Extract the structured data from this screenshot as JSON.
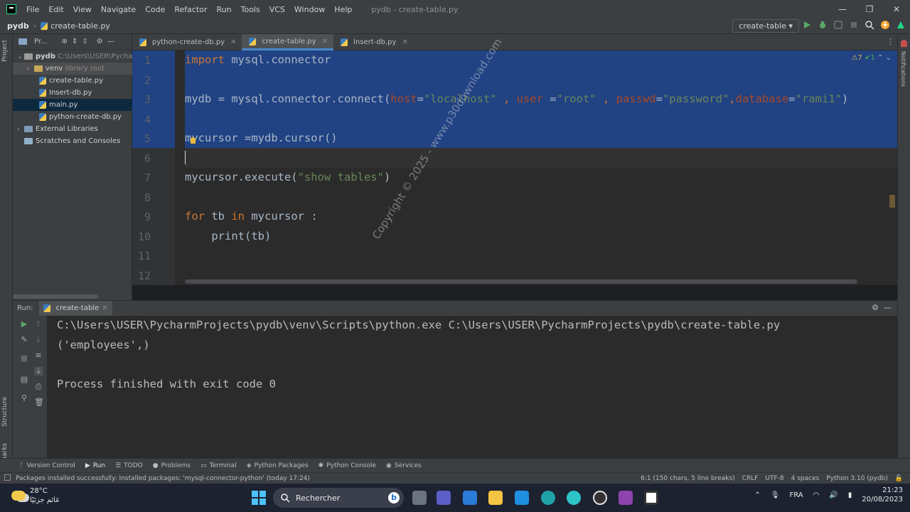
{
  "titlebar": {
    "menu": [
      "File",
      "Edit",
      "View",
      "Navigate",
      "Code",
      "Refactor",
      "Run",
      "Tools",
      "VCS",
      "Window",
      "Help"
    ],
    "title": "pydb - create-table.py",
    "controls": [
      "—",
      "❐",
      "✕"
    ]
  },
  "navbar": {
    "project": "pydb",
    "file": "create-table.py",
    "run_config": "create-table ▾"
  },
  "left_strip": {
    "project": "Project",
    "structure": "Structure",
    "bookmarks": "Bookmarks"
  },
  "right_strip": {
    "notifications": "Notifications"
  },
  "project_panel": {
    "header": "Pr...",
    "tree": [
      {
        "label": "pydb",
        "extra": "C:\\Users\\USER\\Pycharm"
      },
      {
        "label": "venv",
        "extra": "library root"
      },
      {
        "label": "create-table.py"
      },
      {
        "label": "Insert-db.py"
      },
      {
        "label": "main.py"
      },
      {
        "label": "python-create-db.py"
      },
      {
        "label": "External Libraries"
      },
      {
        "label": "Scratches and Consoles"
      }
    ]
  },
  "tabs": [
    {
      "label": "python-create-db.py"
    },
    {
      "label": "create-table.py"
    },
    {
      "label": "Insert-db.py"
    }
  ],
  "editor": {
    "inspections": {
      "warnings": "⚠7",
      "ok": "✔1"
    },
    "line_numbers": [
      "1",
      "2",
      "3",
      "4",
      "5",
      "6",
      "7",
      "8",
      "9",
      "10",
      "11",
      "12"
    ],
    "lines": {
      "l1_kw": "import",
      "l1_rest": " mysql.connector",
      "l3_a": "mydb = mysql.connector.connect(",
      "l3_host": "host",
      "l3_eq1": "=",
      "l3_hostval": "\"localhost\"",
      "l3_sep1": " , ",
      "l3_user": "user",
      "l3_eq2": " =",
      "l3_userval": "\"root\"",
      "l3_sep2": " , ",
      "l3_passwd": "passwd",
      "l3_eq3": "=",
      "l3_passval": "\"password\"",
      "l3_sep3": ",",
      "l3_db": "database",
      "l3_eq4": "=",
      "l3_dbval": "\"rami1\"",
      "l3_close": ")",
      "l5": "mycursor =mydb.cursor()",
      "l7_a": "mycursor.execute(",
      "l7_str": "\"show tables\"",
      "l7_b": ")",
      "l9_for": "for",
      "l9_mid": " tb ",
      "l9_in": "in",
      "l9_rest": " mycursor :",
      "l10": "    print(tb)"
    }
  },
  "watermark": "Copyright © 2025 - www.p30download.com",
  "run_panel": {
    "title": "Run:",
    "tab": "create-table",
    "output": [
      "C:\\Users\\USER\\PycharmProjects\\pydb\\venv\\Scripts\\python.exe C:\\Users\\USER\\PycharmProjects\\pydb\\create-table.py",
      "('employees',)",
      "",
      "Process finished with exit code 0"
    ]
  },
  "tool_tabs": [
    "Version Control",
    "Run",
    "TODO",
    "Problems",
    "Terminal",
    "Python Packages",
    "Python Console",
    "Services"
  ],
  "statusbar": {
    "message": "Packages installed successfully: Installed packages: 'mysql-connector-python' (today 17:24)",
    "position": "6:1 (150 chars, 5 line breaks)",
    "line_sep": "CRLF",
    "encoding": "UTF-8",
    "indent": "4 spaces",
    "interpreter": "Python 3.10 (pydb)"
  },
  "taskbar": {
    "temp": "28°C",
    "weather": "غائم جزئيًا",
    "search": "Rechercher",
    "lang": "FRA",
    "time": "21:23",
    "date": "20/08/2023"
  },
  "colors": {
    "selection": "#214283",
    "keyword": "#cc7832",
    "string": "#6a8759",
    "param": "#aa4926"
  }
}
